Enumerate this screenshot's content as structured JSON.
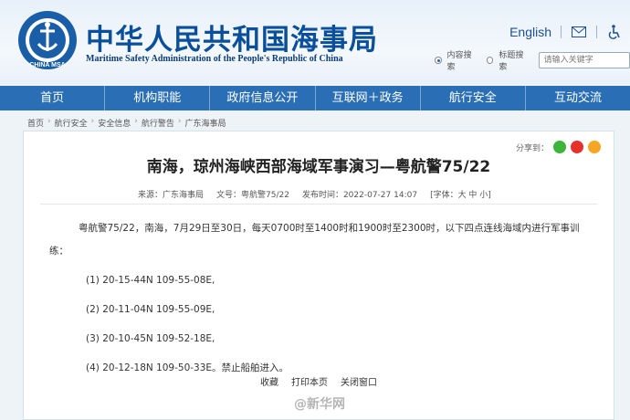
{
  "header": {
    "logo_text": "CHINA MSA",
    "title_cn": "中华人民共和国海事局",
    "title_en": "Maritime Safety Administration of the People's Republic of China",
    "lang_link": "English",
    "search_option_1": "内容搜索",
    "search_option_2": "标题搜索",
    "search_placeholder": "请输入关键字"
  },
  "nav": [
    "首页",
    "机构职能",
    "政府信息公开",
    "互联网＋政务",
    "航行安全",
    "互动交流"
  ],
  "breadcrumb": [
    "首页",
    "航行安全",
    "安全信息",
    "航行警告",
    "广东海事局"
  ],
  "article": {
    "share_label": "分享到：",
    "title": "南海，琼州海峡西部海域军事演习—粤航警75/22",
    "source": "来源：广东海事局",
    "number": "文号：粤航警75/22",
    "time": "发布时间：2022-07-27 14:07",
    "font_size": "[字体：大  中  小]",
    "lead": "粤航警75/22，南海，7月29日至30日，每天0700时至1400时和1900时至2300时，以下四点连线海域内进行军事训练：",
    "points": [
      "(1) 20-15-44N 109-55-08E,",
      "(2) 20-11-04N 109-55-09E,",
      "(3) 20-10-45N 109-52-18E,",
      "(4) 20-12-18N 109-50-33E。禁止船舶进入。"
    ],
    "actions": [
      "收藏",
      "打印本页",
      "关闭窗口"
    ]
  },
  "watermark": "@新华网",
  "colors": {
    "nav_bg": "#2a6fb5",
    "title_blue": "#0a4f9c"
  }
}
